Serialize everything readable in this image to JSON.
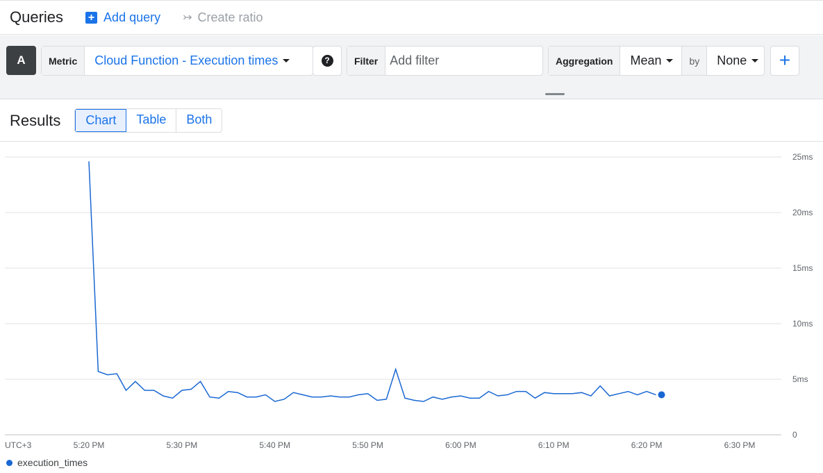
{
  "header": {
    "title": "Queries",
    "add_query": "Add query",
    "create_ratio": "Create ratio"
  },
  "query": {
    "letter": "A",
    "metric_label": "Metric",
    "metric_value": "Cloud Function - Execution times",
    "filter_label": "Filter",
    "filter_placeholder": "Add filter",
    "aggregation_label": "Aggregation",
    "aggregation_value": "Mean",
    "by_label": "by",
    "by_value": "None"
  },
  "results": {
    "title": "Results",
    "tabs": [
      "Chart",
      "Table",
      "Both"
    ],
    "active_tab": "Chart"
  },
  "colors": {
    "accent": "#1a73e8",
    "series": "#1967d2"
  },
  "chart_data": {
    "type": "line",
    "timezone_label": "UTC+3",
    "x_ticks": [
      "5:20 PM",
      "5:30 PM",
      "5:40 PM",
      "5:50 PM",
      "6:00 PM",
      "6:10 PM",
      "6:20 PM",
      "6:30 PM"
    ],
    "y_ticks": [
      "0",
      "5ms",
      "10ms",
      "15ms",
      "20ms",
      "25ms"
    ],
    "ylim": [
      0,
      25
    ],
    "xlim_minutes_after_5pm": [
      12,
      38
    ],
    "series": [
      {
        "name": "execution_times",
        "x": [
          "5:20 PM",
          "5:21 PM",
          "5:22 PM",
          "5:23 PM",
          "5:24 PM",
          "5:25 PM",
          "5:26 PM",
          "5:27 PM",
          "5:28 PM",
          "5:29 PM",
          "5:30 PM",
          "5:31 PM",
          "5:32 PM",
          "5:33 PM",
          "5:34 PM",
          "5:35 PM",
          "5:36 PM",
          "5:37 PM",
          "5:38 PM",
          "5:39 PM",
          "5:40 PM",
          "5:41 PM",
          "5:42 PM",
          "5:43 PM",
          "5:44 PM",
          "5:45 PM",
          "5:46 PM",
          "5:47 PM",
          "5:48 PM",
          "5:49 PM",
          "5:50 PM",
          "5:51 PM",
          "5:52 PM",
          "5:53 PM",
          "5:54 PM",
          "5:55 PM",
          "5:56 PM",
          "5:57 PM",
          "5:58 PM",
          "5:59 PM",
          "6:00 PM",
          "6:01 PM",
          "6:02 PM",
          "6:03 PM",
          "6:04 PM",
          "6:05 PM",
          "6:06 PM",
          "6:07 PM",
          "6:08 PM",
          "6:09 PM",
          "6:10 PM",
          "6:11 PM",
          "6:12 PM",
          "6:13 PM",
          "6:14 PM",
          "6:15 PM",
          "6:16 PM",
          "6:17 PM",
          "6:18 PM",
          "6:19 PM",
          "6:20 PM",
          "6:21 PM"
        ],
        "values": [
          24.6,
          5.7,
          5.4,
          5.5,
          4.0,
          4.8,
          4.0,
          4.0,
          3.5,
          3.3,
          4.0,
          4.1,
          4.8,
          3.4,
          3.3,
          3.9,
          3.8,
          3.4,
          3.4,
          3.6,
          3.0,
          3.2,
          3.8,
          3.6,
          3.4,
          3.4,
          3.5,
          3.4,
          3.4,
          3.6,
          3.7,
          3.1,
          3.2,
          5.9,
          3.3,
          3.1,
          3.0,
          3.4,
          3.2,
          3.4,
          3.5,
          3.3,
          3.3,
          3.9,
          3.5,
          3.6,
          3.9,
          3.9,
          3.3,
          3.8,
          3.7,
          3.7,
          3.7,
          3.8,
          3.5,
          4.4,
          3.5,
          3.7,
          3.9,
          3.6,
          3.9,
          3.6
        ]
      }
    ]
  }
}
